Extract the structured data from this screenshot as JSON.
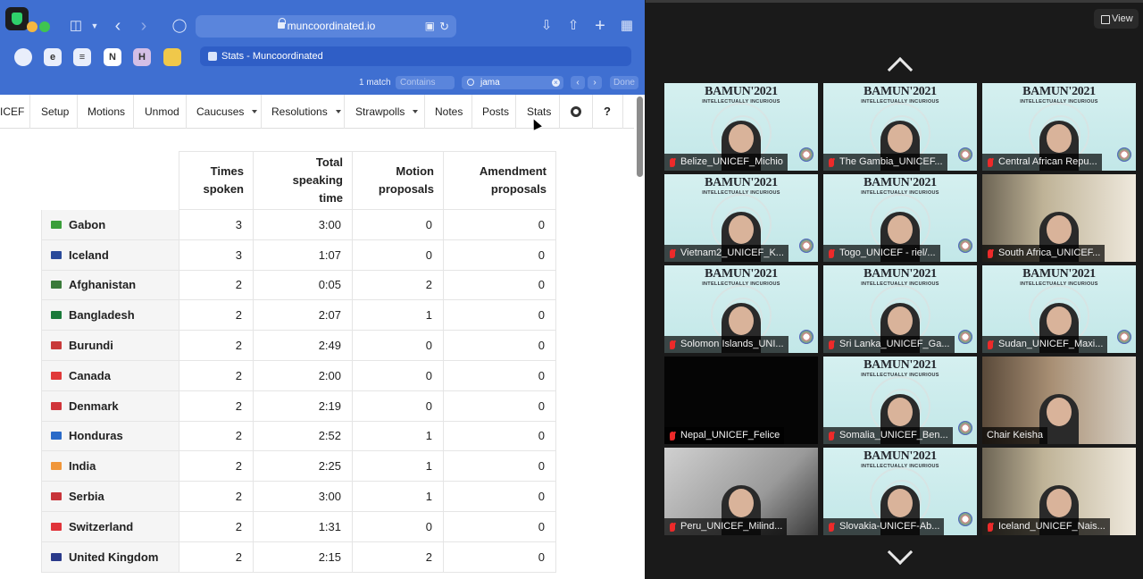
{
  "browser": {
    "url": "muncoordinated.io",
    "active_tab_title": "Stats - Muncoordinated",
    "favorites": [
      "safari-icon",
      "e-icon",
      "reader-icon",
      "notion-icon",
      "h-icon",
      "chart-icon"
    ],
    "fav_letters": {
      "e": "e",
      "notion": "N",
      "h": "H"
    },
    "find": {
      "match_count": "1 match",
      "mode": "Contains",
      "query": "jama",
      "done_label": "Done"
    }
  },
  "app": {
    "nav": {
      "committee": "ICEF",
      "setup": "Setup",
      "motions": "Motions",
      "unmod": "Unmod",
      "caucuses": "Caucuses",
      "resolutions": "Resolutions",
      "strawpolls": "Strawpolls",
      "notes": "Notes",
      "posts": "Posts",
      "stats": "Stats",
      "help": "?"
    },
    "stats_table": {
      "headers": {
        "times_spoken": [
          "Times",
          "spoken"
        ],
        "total_speaking_time": [
          "Total speaking",
          "time"
        ],
        "motion_proposals": [
          "Motion",
          "proposals"
        ],
        "amendment_proposals": [
          "Amendment",
          "proposals"
        ]
      },
      "rows": [
        {
          "country": "Gabon",
          "flag_color": "#3a9e3a",
          "times": "3",
          "time": "3:00",
          "motions": "0",
          "amendments": "0"
        },
        {
          "country": "Iceland",
          "flag_color": "#2a4a9a",
          "times": "3",
          "time": "1:07",
          "motions": "0",
          "amendments": "0"
        },
        {
          "country": "Afghanistan",
          "flag_color": "#3a7a3a",
          "times": "2",
          "time": "0:05",
          "motions": "2",
          "amendments": "0"
        },
        {
          "country": "Bangladesh",
          "flag_color": "#1a7a3a",
          "times": "2",
          "time": "2:07",
          "motions": "1",
          "amendments": "0"
        },
        {
          "country": "Burundi",
          "flag_color": "#c83a3a",
          "times": "2",
          "time": "2:49",
          "motions": "0",
          "amendments": "0"
        },
        {
          "country": "Canada",
          "flag_color": "#e03a3a",
          "times": "2",
          "time": "2:00",
          "motions": "0",
          "amendments": "0"
        },
        {
          "country": "Denmark",
          "flag_color": "#d0343a",
          "times": "2",
          "time": "2:19",
          "motions": "0",
          "amendments": "0"
        },
        {
          "country": "Honduras",
          "flag_color": "#2a6ac8",
          "times": "2",
          "time": "2:52",
          "motions": "1",
          "amendments": "0"
        },
        {
          "country": "India",
          "flag_color": "#f0963a",
          "times": "2",
          "time": "2:25",
          "motions": "1",
          "amendments": "0"
        },
        {
          "country": "Serbia",
          "flag_color": "#c8343a",
          "times": "2",
          "time": "3:00",
          "motions": "1",
          "amendments": "0"
        },
        {
          "country": "Switzerland",
          "flag_color": "#e0343a",
          "times": "2",
          "time": "1:31",
          "motions": "0",
          "amendments": "0"
        },
        {
          "country": "United Kingdom",
          "flag_color": "#2a3a8a",
          "times": "2",
          "time": "2:15",
          "motions": "2",
          "amendments": "0"
        }
      ]
    }
  },
  "zoom": {
    "view_label": "View",
    "brand": "BAMUN'2021",
    "subtitle": "INTELLECTUALLY INCURIOUS",
    "participants": [
      {
        "name": "Belize_UNICEF_Michio",
        "muted": true,
        "bg": "brand"
      },
      {
        "name": "The Gambia_UNICEF...",
        "muted": true,
        "bg": "brand"
      },
      {
        "name": "Central African Repu...",
        "muted": true,
        "bg": "brand"
      },
      {
        "name": "Vietnam2_UNICEF_K...",
        "muted": true,
        "bg": "brand"
      },
      {
        "name": "Togo_UNICEF - riel/...",
        "muted": true,
        "bg": "brand"
      },
      {
        "name": "South Africa_UNICEF...",
        "muted": true,
        "bg": "room"
      },
      {
        "name": "Solomon Islands_UNI...",
        "muted": true,
        "bg": "brand"
      },
      {
        "name": "Sri Lanka_UNICEF_Ga...",
        "muted": true,
        "bg": "brand"
      },
      {
        "name": "Sudan_UNICEF_Maxi...",
        "muted": true,
        "bg": "brand"
      },
      {
        "name": "Nepal_UNICEF_Felice",
        "muted": true,
        "bg": "dark"
      },
      {
        "name": "Somalia_UNICEF_Ben...",
        "muted": true,
        "bg": "brand"
      },
      {
        "name": "Chair Keisha",
        "muted": false,
        "bg": "room2"
      },
      {
        "name": "Peru_UNICEF_Milind...",
        "muted": true,
        "bg": "blur"
      },
      {
        "name": "Slovakia-UNICEF-Ab...",
        "muted": true,
        "bg": "brand"
      },
      {
        "name": "Iceland_UNICEF_Nais...",
        "muted": true,
        "bg": "room"
      }
    ]
  },
  "colors": {
    "browser_chrome": "#3f6fd1",
    "active_tab": "#2f5ec6",
    "mute_red": "#ee2a2a",
    "zoom_bg": "#1a1a1a"
  }
}
